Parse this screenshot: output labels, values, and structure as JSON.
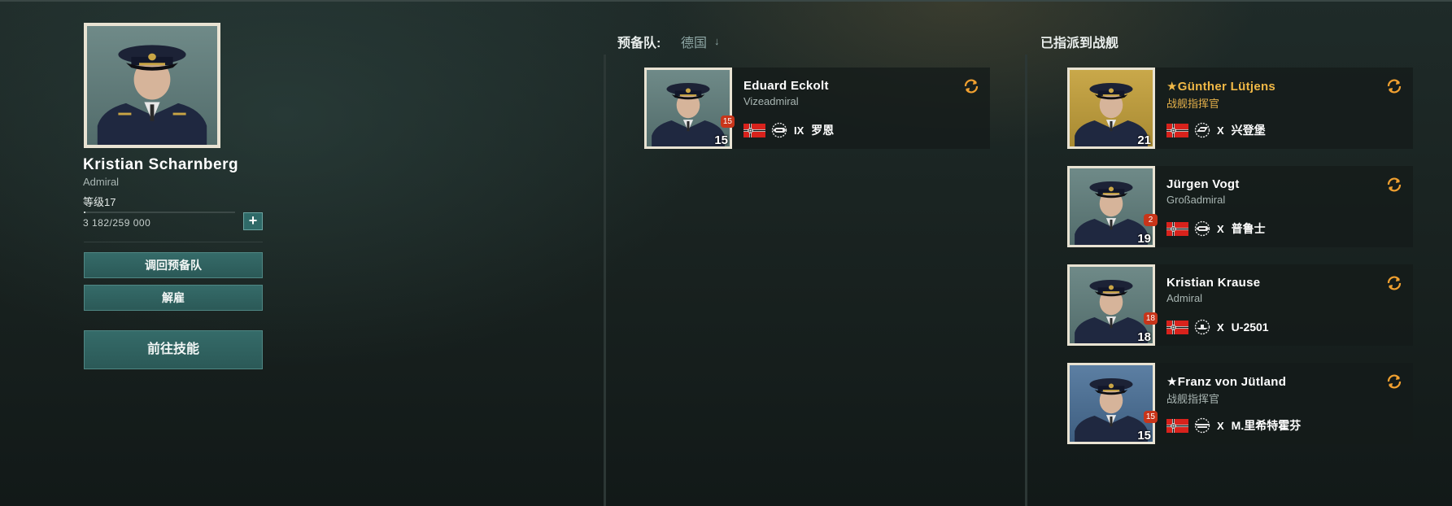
{
  "selected": {
    "name": "Kristian  Scharnberg",
    "rank": "Admiral",
    "level": "等级17",
    "xp": "3  182/259  000",
    "xp_progress": 0.012,
    "plus_label": "+",
    "portrait_bg": "grey",
    "buttons": {
      "recall": "调回预备队",
      "dismiss": "解雇",
      "skills": "前往技能"
    }
  },
  "reserve": {
    "header": "预备队:",
    "filter": "德国",
    "commanders": [
      {
        "name": "Eduard  Eckolt",
        "subtitle": "Vizeadmiral",
        "level": "15",
        "badge": "15",
        "tier": "IX",
        "ship": "罗恩",
        "ship_class": "battleship-icon",
        "portrait_bg": "grey",
        "highlight": false
      }
    ]
  },
  "assigned": {
    "header": "已指派到战舰",
    "commanders": [
      {
        "name": "★Günther  Lütjens",
        "subtitle": "战舰指挥官",
        "level": "21",
        "badge": "",
        "tier": "X",
        "ship": "兴登堡",
        "ship_class": "cruiser-icon",
        "portrait_bg": "gold",
        "highlight": true
      },
      {
        "name": "Jürgen  Vogt",
        "subtitle": "Großadmiral",
        "level": "19",
        "badge": "2",
        "tier": "X",
        "ship": "普鲁士",
        "ship_class": "battleship-icon",
        "portrait_bg": "grey",
        "highlight": false
      },
      {
        "name": "Kristian  Krause",
        "subtitle": "Admiral",
        "level": "18",
        "badge": "18",
        "tier": "X",
        "ship": "U-2501",
        "ship_class": "submarine-icon",
        "portrait_bg": "grey",
        "highlight": false
      },
      {
        "name": "★Franz  von  Jütland",
        "subtitle": "战舰指挥官",
        "level": "15",
        "badge": "15",
        "tier": "X",
        "ship": "M.里希特霍芬",
        "ship_class": "carrier-icon",
        "portrait_bg": "blue",
        "highlight": false
      }
    ]
  },
  "colors": {
    "accent_button": "#2f6a68",
    "badge_red": "#c8351a",
    "swap_orange": "#f0a030",
    "gold_text": "#f0b846"
  }
}
